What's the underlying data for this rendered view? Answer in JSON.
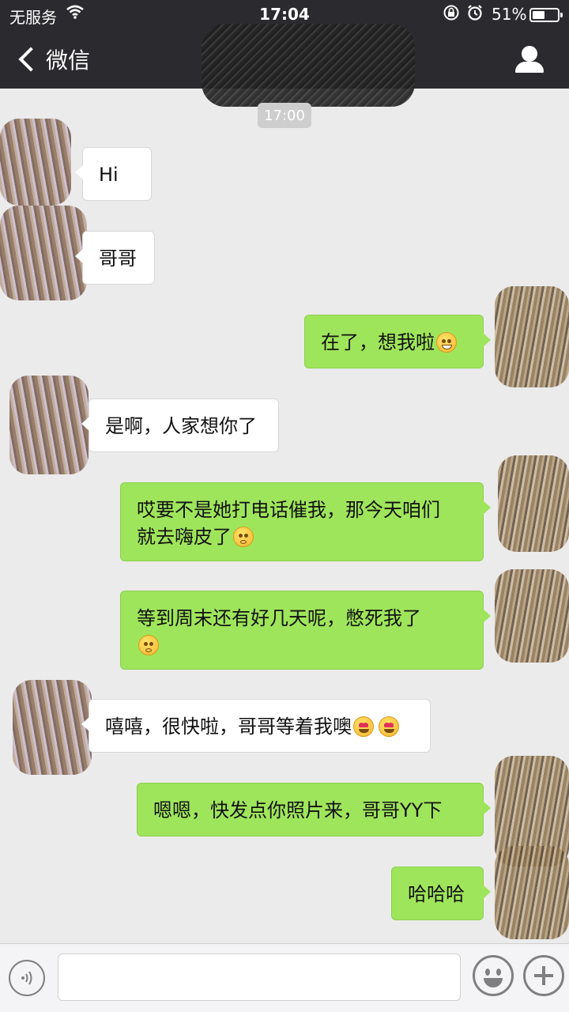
{
  "status_bar": {
    "carrier": "无服务",
    "time": "17:04",
    "battery_percent": "51%",
    "battery_level": 0.51,
    "icons": [
      "wifi-icon",
      "rotation-lock-icon",
      "alarm-icon",
      "battery-icon"
    ]
  },
  "navbar": {
    "back_label": "微信",
    "icons": [
      "chevron-left-icon",
      "profile-icon"
    ]
  },
  "chat": {
    "timestamp": "17:00",
    "messages": [
      {
        "side": "in",
        "text": "Hi"
      },
      {
        "side": "in",
        "text": "哥哥"
      },
      {
        "side": "out",
        "text": "在了，想我啦",
        "emoji": [
          "grin-emoji"
        ]
      },
      {
        "side": "in",
        "text": "是啊，人家想你了"
      },
      {
        "side": "out",
        "text_line1": "哎要不是她打电话催我，那今天咱们",
        "text_line2": "就去嗨皮了",
        "emoji": [
          "flushed-emoji"
        ]
      },
      {
        "side": "out",
        "text_line1": "等到周末还有好几天呢，憋死我了",
        "text_line2": "",
        "emoji": [
          "flushed-emoji"
        ]
      },
      {
        "side": "in",
        "text": "嘻嘻，很快啦，哥哥等着我噢",
        "emoji": [
          "heart-eyes-emoji",
          "heart-eyes-emoji"
        ]
      },
      {
        "side": "out",
        "text": "嗯嗯，快发点你照片来，哥哥YY下"
      },
      {
        "side": "out",
        "text": "哈哈哈"
      }
    ]
  },
  "input_bar": {
    "placeholder": "",
    "icons": [
      "voice-icon",
      "emoji-icon",
      "plus-icon"
    ]
  },
  "colors": {
    "header_bg": "#2b2b2f",
    "chat_bg": "#ebebeb",
    "outgoing_bubble": "#9fe55b",
    "incoming_bubble": "#ffffff"
  }
}
